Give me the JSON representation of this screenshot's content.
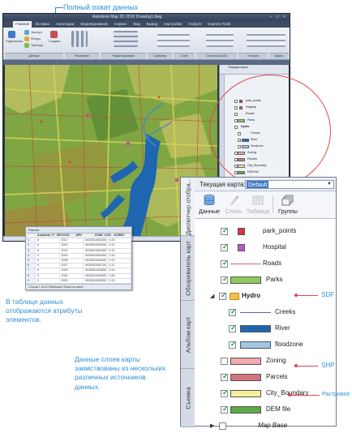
{
  "annotations": {
    "top": "Полный охват данных",
    "table_note": "В таблице данных отображаются атрибуты элементов.",
    "sources_note": "Данные слоев карты заимствованы из нескольких различных источников данных.",
    "sdf": "SDF",
    "shp": "SHP",
    "raster": "Растровое"
  },
  "app": {
    "title": "Autodesk Map 3D 2010   Drawing1.dwg",
    "window_controls": "– □ ×",
    "tabs": [
      "Главная",
      "Вставка",
      "Аннотации",
      "Моделирование",
      "Сервис",
      "Вид",
      "Вывод",
      "Настройки",
      "Analyze",
      "Express Tools"
    ],
    "ribbon_groups": [
      "Данные",
      "Рисование",
      "Редактирование",
      "Свойства",
      "Слой",
      "Стили AutoCAD",
      "Утилиты",
      "Буфер"
    ],
    "ribbon_labels": [
      "Подключить",
      "Экспорт",
      "Ресурс",
      "Таблица",
      "Создать"
    ]
  },
  "mini_pane": {
    "title": "Текущая карта:",
    "layers": [
      "park_points",
      "Hospital",
      "Roads",
      "Parks",
      "Hydro",
      "Creeks",
      "River",
      "floodzone",
      "Zoning",
      "Parcels",
      "City_Boundary",
      "DEM file",
      "Map Base"
    ]
  },
  "data_table": {
    "title": "Parcels",
    "columns": [
      "Autodesk_FDO",
      "GEOCOD",
      "APN",
      "ZONE_CODE",
      "ACRES"
    ],
    "rows": [
      [
        "1",
        "0",
        "2017",
        "0020001002200",
        "0.13"
      ],
      [
        "2",
        "0",
        "2019",
        "0020001002300",
        "0.13"
      ],
      [
        "3",
        "0",
        "2021",
        "0020001002400",
        "0.12"
      ],
      [
        "4",
        "0",
        "2023",
        "0020001002500",
        "0.14"
      ],
      [
        "5",
        "0",
        "2025",
        "0020001002600",
        "0.13"
      ],
      [
        "6",
        "0",
        "2027",
        "0020001002700",
        "0.11"
      ],
      [
        "7",
        "0",
        "2029",
        "0020001002800",
        "0.13"
      ],
      [
        "8",
        "0",
        "2031",
        "0020001002900",
        "0.15"
      ],
      [
        "9",
        "0",
        "2033",
        "0020001003000",
        "0.12"
      ]
    ],
    "footer": "Строка 1   из 8    0 Выбрано   Показ на карте"
  },
  "pane": {
    "current_map_label": "Текущая карта:",
    "current_map_value": "Default",
    "side_tabs": [
      "Диспетчер отобра...",
      "Обозреватель карт",
      "Альбом карт",
      "Съемка"
    ],
    "toolbar": [
      {
        "label": "Данные",
        "disabled": false,
        "icon": "data-cylinder-icon"
      },
      {
        "label": "Стиль",
        "disabled": true,
        "icon": "style-brush-icon"
      },
      {
        "label": "Таблица",
        "disabled": true,
        "icon": "table-grid-icon"
      },
      {
        "label": "Группы",
        "disabled": false,
        "icon": "groups-stack-icon"
      }
    ],
    "layers": [
      {
        "name": "park_points",
        "checked": true,
        "swatch": "box",
        "color": "#d9333f"
      },
      {
        "name": "Hospital",
        "checked": true,
        "swatch": "box",
        "color": "#b35bc2"
      },
      {
        "name": "Roads",
        "checked": true,
        "swatch": "line",
        "color": "#d96b70"
      },
      {
        "name": "Parks",
        "checked": true,
        "swatch": "rect",
        "color": "#8dcc5c"
      },
      {
        "name": "Hydro",
        "checked": true,
        "swatch": "folder",
        "color": "#f2c14a"
      },
      {
        "name": "Creeks",
        "checked": true,
        "swatch": "line",
        "color": "#4a6fa8"
      },
      {
        "name": "River",
        "checked": true,
        "swatch": "rect",
        "color": "#1f66b0"
      },
      {
        "name": "floodzone",
        "checked": true,
        "swatch": "rect",
        "color": "#9fc7e8"
      },
      {
        "name": "Zoning",
        "checked": false,
        "swatch": "rect",
        "color": "#f0a9ad"
      },
      {
        "name": "Parcels",
        "checked": true,
        "swatch": "rect",
        "color": "#d3737d"
      },
      {
        "name": "City_Boundary",
        "checked": true,
        "swatch": "rect",
        "color": "#f3ee9c"
      },
      {
        "name": "DEM file",
        "checked": true,
        "swatch": "rect",
        "color": "#5fa845"
      },
      {
        "name": "Map Base",
        "checked": false,
        "swatch": "none",
        "color": "#ffffff"
      }
    ]
  }
}
